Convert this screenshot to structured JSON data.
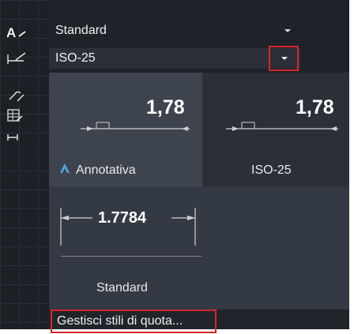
{
  "text_style": {
    "value": "Standard",
    "icon": "text-style-icon"
  },
  "dim_style": {
    "value": "ISO-25",
    "icon": "dim-style-icon"
  },
  "rail_icons": [
    "multileader-icon",
    "table-style-icon",
    "dimension-insert-icon"
  ],
  "gallery": {
    "annotativa": {
      "preview_value": "1,78",
      "label": "Annotativa",
      "icon": "annotative-icon"
    },
    "iso25": {
      "preview_value": "1,78",
      "label": "ISO-25"
    },
    "standard": {
      "preview_value": "1.7784",
      "label": "Standard"
    }
  },
  "footer": {
    "manage_label": "Gestisci stili di quota..."
  },
  "colors": {
    "highlight": "#d9242b",
    "annotative_accent": "#4ea7e6"
  }
}
